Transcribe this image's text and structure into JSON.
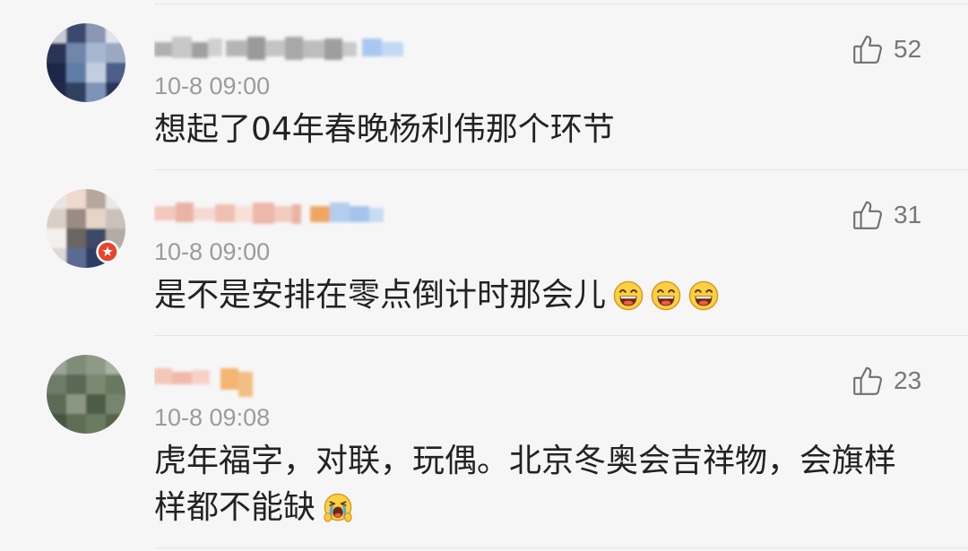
{
  "theme": {
    "background": "#f6f6f6",
    "text": "#222222",
    "meta": "#9b9b9b",
    "divider": "#e4e4e4",
    "count": "#777777",
    "badge": "#e8442e"
  },
  "icons": {
    "like": "thumbs-up-icon",
    "avatar_badge": "avatar-badge-icon"
  },
  "comments": [
    {
      "time": "10-8 09:00",
      "likes": 52,
      "text": "想起了04年春晚杨利伟那个环节",
      "emoji": []
    },
    {
      "time": "10-8 09:00",
      "likes": 31,
      "text": "是不是安排在零点倒计时那会儿",
      "emoji": [
        "laughing-emoji",
        "laughing-emoji",
        "laughing-emoji"
      ]
    },
    {
      "time": "10-8 09:08",
      "likes": 23,
      "text": "虎年福字，对联，玩偶。北京冬奥会吉祥物，会旗样样都不能缺",
      "emoji": [
        "tearful-laugh-emoji"
      ]
    }
  ]
}
